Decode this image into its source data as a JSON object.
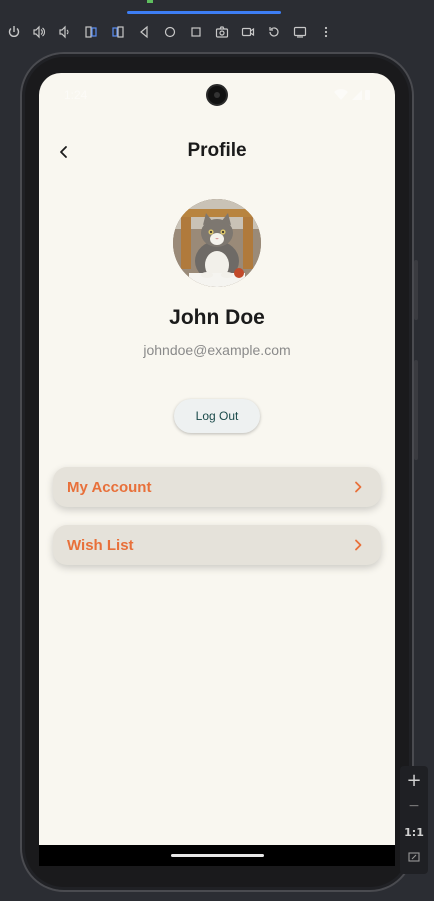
{
  "emulator": {
    "toolbar_icons": [
      "power-icon",
      "volume-up-icon",
      "volume-down-icon",
      "rotate-left-icon",
      "rotate-right-icon",
      "back-icon",
      "home-icon",
      "overview-icon",
      "camera-icon",
      "screenrecord-icon",
      "replay-icon",
      "snapshot-icon",
      "more-icon"
    ],
    "zoom": {
      "plus": "+",
      "minus": "−",
      "ratio": "1:1"
    }
  },
  "status_bar": {
    "time": "1:24"
  },
  "header": {
    "title": "Profile"
  },
  "profile": {
    "name": "John Doe",
    "email": "johndoe@example.com"
  },
  "actions": {
    "logout_label": "Log Out"
  },
  "menu": {
    "items": [
      {
        "label": "My Account"
      },
      {
        "label": "Wish List"
      }
    ]
  },
  "colors": {
    "background": "#f9f7f0",
    "accent": "#e8703a",
    "card": "#e5e2da",
    "title": "#1b1b1b",
    "email": "#8a8a8a"
  }
}
